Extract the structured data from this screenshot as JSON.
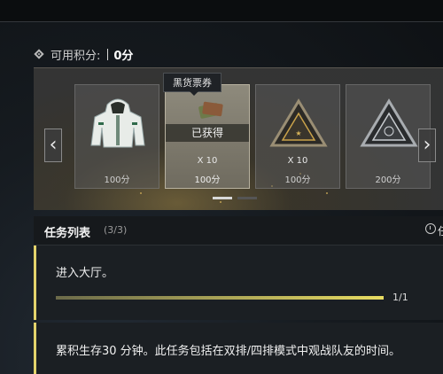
{
  "points": {
    "label": "可用积分:",
    "value": "0分"
  },
  "tooltip": "黑货票券",
  "carousel": {
    "items": [
      {
        "name": "hoodie",
        "qty": "",
        "price": "100分",
        "obtained": false
      },
      {
        "name": "black-goods-ticket",
        "qty": "X 10",
        "price": "100分",
        "obtained": true,
        "obtained_label": "已获得"
      },
      {
        "name": "gold-triangle-token",
        "qty": "X 10",
        "price": "100分",
        "obtained": false
      },
      {
        "name": "silver-triangle-token",
        "qty": "",
        "price": "200分",
        "obtained": false
      }
    ],
    "page": 1,
    "pages": 2
  },
  "tasks": {
    "title": "任务列表",
    "count": "(3/3)",
    "timer_label": "任",
    "items": [
      {
        "desc": "进入大厅。",
        "progress_text": "1/1",
        "progress": 1.0
      },
      {
        "desc": "累积生存30 分钟。此任务包括在双排/四排模式中观战队友的时间。"
      }
    ]
  },
  "icons": {
    "left": "chevron-left-icon",
    "right": "chevron-right-icon",
    "clock": "clock-icon"
  },
  "colors": {
    "accent": "#e3d36b"
  }
}
